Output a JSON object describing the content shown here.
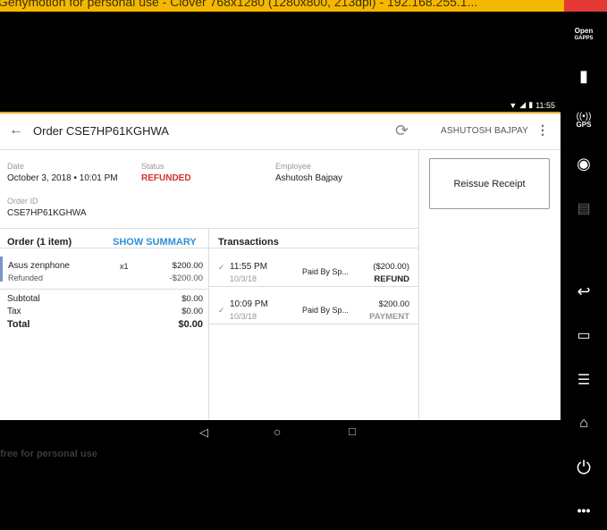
{
  "window": {
    "title": "Genymotion for personal use - Clover 768x1280 (1280x800, 213dpi) - 192.168.255.1..."
  },
  "statusbar": {
    "time": "11:55"
  },
  "sidebar": {
    "opengapps_line1": "Open",
    "opengapps_line2": "GAPPS",
    "gps_label": "GPS"
  },
  "appbar": {
    "title": "Order CSE7HP61KGHWA",
    "user": "ASHUTOSH BAJPAY"
  },
  "details": {
    "date_label": "Date",
    "date_value": "October 3, 2018 • 10:01 PM",
    "status_label": "Status",
    "status_value": "REFUNDED",
    "employee_label": "Employee",
    "employee_value": "Ashutosh Bajpay",
    "orderid_label": "Order ID",
    "orderid_value": "CSE7HP61KGHWA"
  },
  "actions": {
    "reissue_label": "Reissue Receipt"
  },
  "order": {
    "title": "Order (1 item)",
    "show_summary": "SHOW SUMMARY",
    "item": {
      "name": "Asus zenphone",
      "status": "Refunded",
      "qty": "x1",
      "price": "$200.00",
      "refund": "-$200.00"
    },
    "subtotal_label": "Subtotal",
    "subtotal_value": "$0.00",
    "tax_label": "Tax",
    "tax_value": "$0.00",
    "total_label": "Total",
    "total_value": "$0.00"
  },
  "transactions": {
    "title": "Transactions",
    "rows": [
      {
        "time": "11:55 PM",
        "date": "10/3/18",
        "method": "Paid By Sp...",
        "amount": "($200.00)",
        "type": "REFUND"
      },
      {
        "time": "10:09 PM",
        "date": "10/3/18",
        "method": "Paid By Sp...",
        "amount": "$200.00",
        "type": "PAYMENT"
      }
    ]
  },
  "watermark": "free for personal use",
  "colors": {
    "accent": "#2f8fd8",
    "refund_red": "#d32f2f",
    "titlebar": "#f5b800"
  }
}
